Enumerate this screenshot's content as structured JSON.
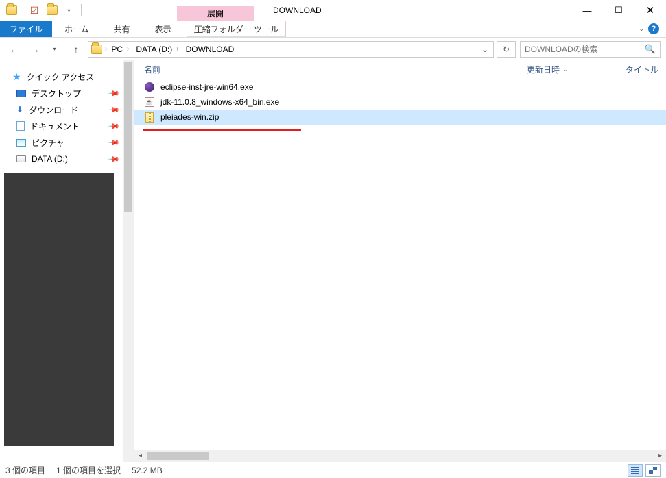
{
  "titlebar": {
    "context_tab_label": "展開",
    "window_title": "DOWNLOAD"
  },
  "ribbon": {
    "file_label": "ファイル",
    "tabs": [
      "ホーム",
      "共有",
      "表示"
    ],
    "tool_tab_label": "圧縮フォルダー ツール"
  },
  "nav": {
    "breadcrumbs": [
      "PC",
      "DATA (D:)",
      "DOWNLOAD"
    ],
    "search_placeholder": "DOWNLOADの検索"
  },
  "sidebar": {
    "quick_access_label": "クイック アクセス",
    "items": [
      {
        "label": "デスクトップ",
        "icon": "desktop"
      },
      {
        "label": "ダウンロード",
        "icon": "download"
      },
      {
        "label": "ドキュメント",
        "icon": "document"
      },
      {
        "label": "ピクチャ",
        "icon": "picture"
      },
      {
        "label": "DATA (D:)",
        "icon": "drive"
      }
    ]
  },
  "columns": {
    "name": "名前",
    "date": "更新日時",
    "title": "タイトル"
  },
  "files": [
    {
      "name": "eclipse-inst-jre-win64.exe",
      "icon": "exe",
      "selected": false
    },
    {
      "name": "jdk-11.0.8_windows-x64_bin.exe",
      "icon": "java",
      "selected": false
    },
    {
      "name": "pleiades-win.zip",
      "icon": "zip",
      "selected": true
    }
  ],
  "status": {
    "count_text": "3 個の項目",
    "selection_text": "1 個の項目を選択",
    "size_text": "52.2 MB"
  }
}
